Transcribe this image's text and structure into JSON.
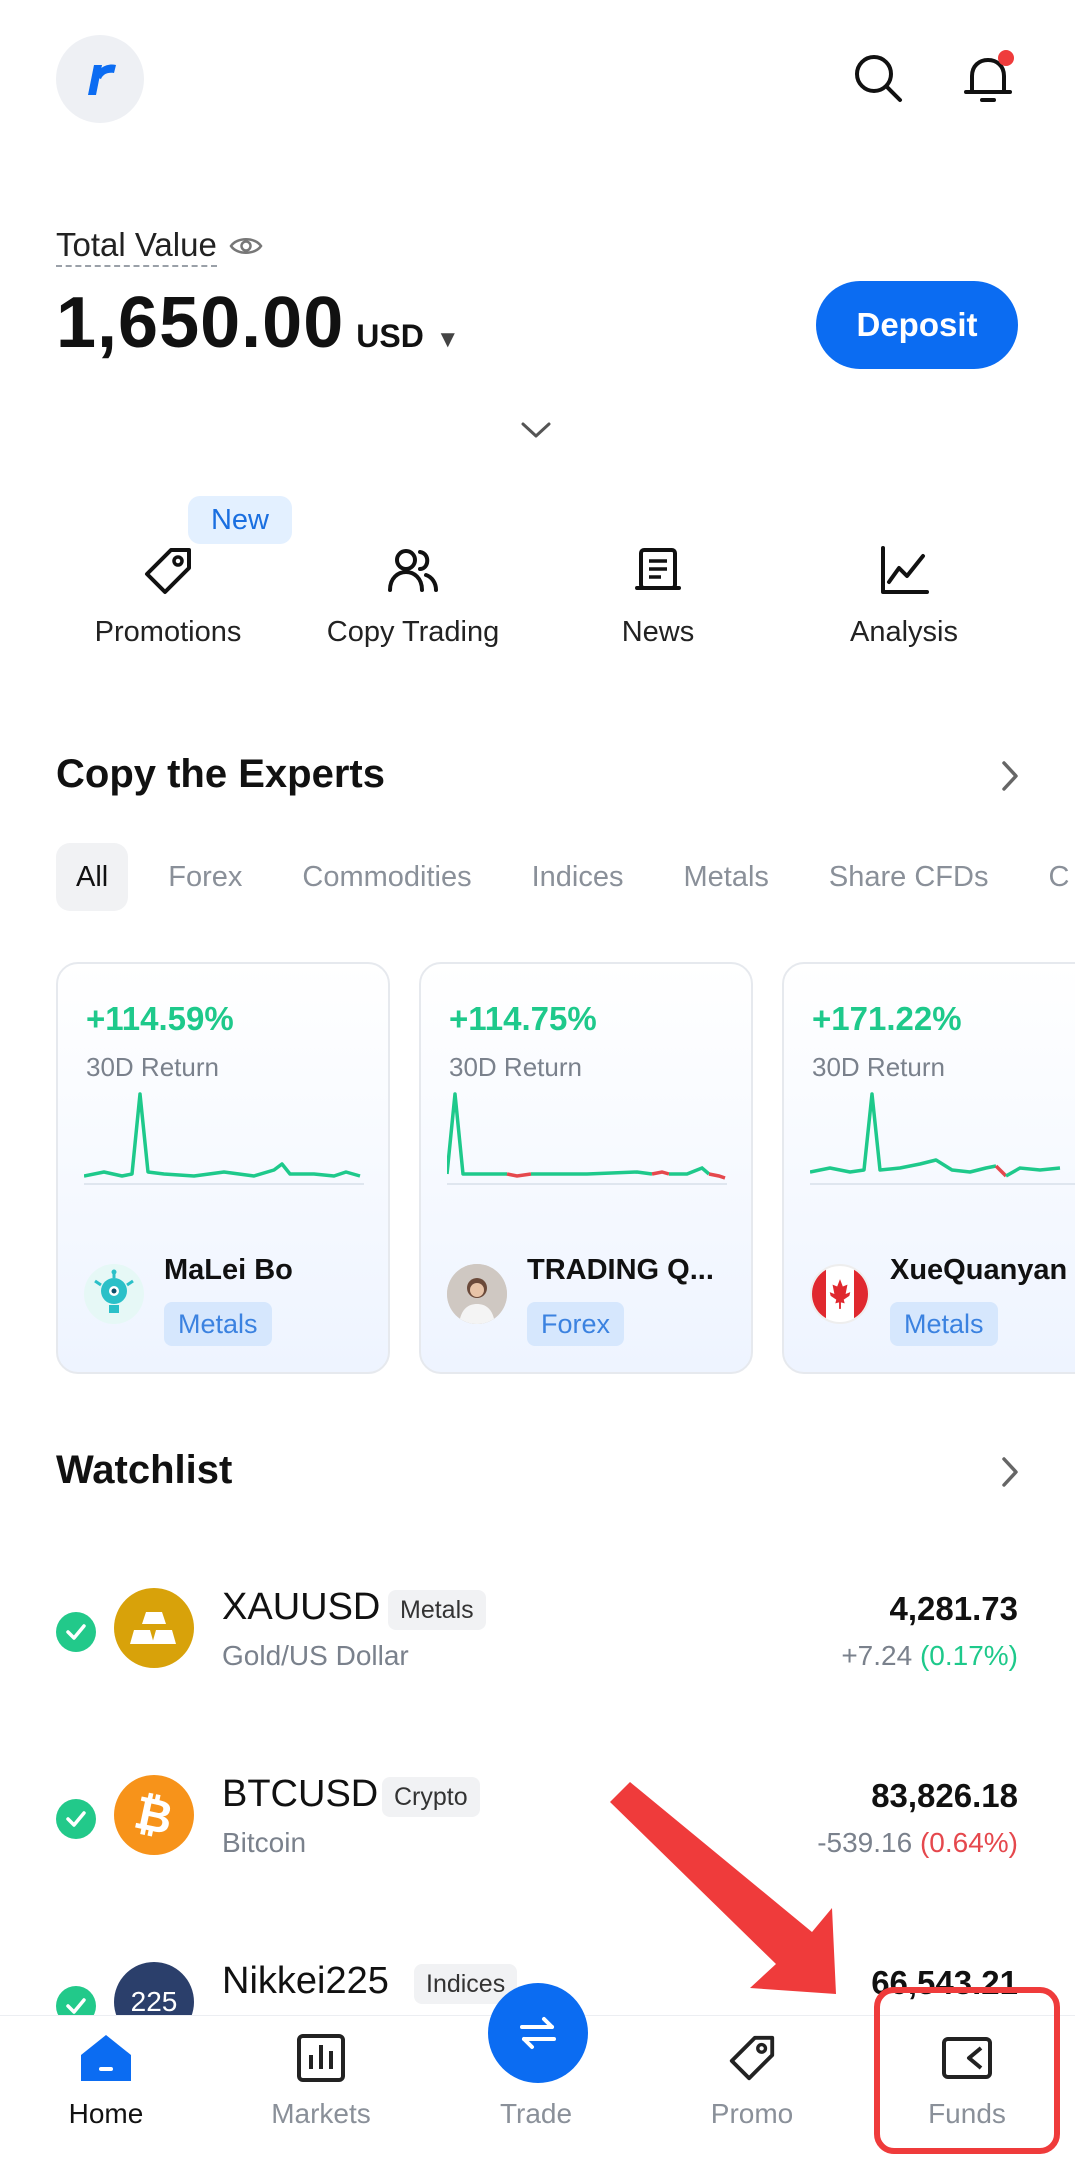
{
  "header": {
    "logo_icon": "brand-logo",
    "search_icon": "search-icon",
    "bell_icon": "bell-icon"
  },
  "account": {
    "total_value_label": "Total Value",
    "amount": "1,650.00",
    "currency": "USD",
    "deposit_label": "Deposit"
  },
  "quick_actions": {
    "new_badge": "New",
    "items": [
      {
        "label": "Promotions",
        "icon": "tag-icon"
      },
      {
        "label": "Copy Trading",
        "icon": "users-icon"
      },
      {
        "label": "News",
        "icon": "news-icon"
      },
      {
        "label": "Analysis",
        "icon": "chart-line-icon"
      }
    ]
  },
  "experts": {
    "title": "Copy the Experts",
    "filters": [
      "All",
      "Forex",
      "Commodities",
      "Indices",
      "Metals",
      "Share CFDs",
      "C"
    ],
    "active_filter": "All",
    "return_label": "30D Return",
    "cards": [
      {
        "return": "+114.59%",
        "name": "MaLei Bo",
        "tag": "Metals"
      },
      {
        "return": "+114.75%",
        "name": "TRADING Q...",
        "tag": "Forex"
      },
      {
        "return": "+171.22%",
        "name": "XueQuanyan",
        "tag": "Metals"
      }
    ]
  },
  "watchlist": {
    "title": "Watchlist",
    "items": [
      {
        "ticker": "XAUUSD",
        "category": "Metals",
        "description": "Gold/US Dollar",
        "price": "4,281.73",
        "change": "+7.24",
        "change_pct": "(0.17%)",
        "direction": "up",
        "icon_color": "#d8a20a"
      },
      {
        "ticker": "BTCUSD",
        "category": "Crypto",
        "description": "Bitcoin",
        "price": "83,826.18",
        "change": "-539.16",
        "change_pct": "(0.64%)",
        "direction": "down",
        "icon_color": "#f7931a"
      },
      {
        "ticker": "Nikkei225",
        "category": "Indices",
        "description": "",
        "price": "66,543.21",
        "change": "",
        "change_pct": "",
        "direction": "up",
        "icon_color": "#2b3f6b",
        "icon_text": "225"
      }
    ]
  },
  "bottom_nav": {
    "items": [
      {
        "label": "Home",
        "icon": "home-icon",
        "active": true
      },
      {
        "label": "Markets",
        "icon": "bar-chart-icon",
        "active": false
      },
      {
        "label": "Trade",
        "icon": "swap-icon",
        "active": false
      },
      {
        "label": "Promo",
        "icon": "tag-icon",
        "active": false
      },
      {
        "label": "Funds",
        "icon": "wallet-icon",
        "active": false
      }
    ]
  },
  "colors": {
    "accent": "#0b6cf2",
    "positive": "#1ec98b",
    "negative": "#e5484d",
    "annotation": "#ef3b3b"
  }
}
